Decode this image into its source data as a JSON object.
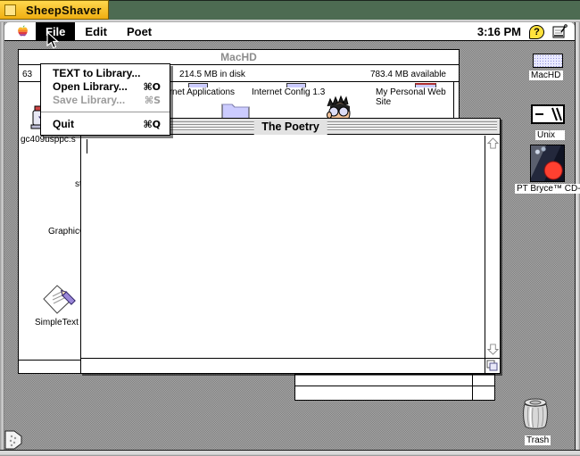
{
  "emulator": {
    "tab_title": "SheepShaver",
    "colors": {
      "tab_yellow": "#f2b613",
      "frame_green": "#4d6b52",
      "lavender": "#ccccff"
    }
  },
  "menubar": {
    "apple_icon": "rainbow-apple-logo",
    "menus": [
      {
        "label": "File",
        "highlighted": true
      },
      {
        "label": "Edit",
        "highlighted": false
      },
      {
        "label": "Poet",
        "highlighted": false
      }
    ],
    "clock": "3:16 PM",
    "help_glyph": "?",
    "app_icon": "active-application-icon"
  },
  "file_menu": {
    "items": [
      {
        "label": "TEXT to Library...",
        "shortcut": "",
        "disabled": false
      },
      {
        "label": "Open Library...",
        "shortcut": "⌘O",
        "disabled": false
      },
      {
        "label": "Save Library...",
        "shortcut": "⌘S",
        "disabled": true
      },
      {
        "label": "Quit",
        "shortcut": "⌘Q",
        "disabled": false
      }
    ]
  },
  "machd_window": {
    "title": "MacHD",
    "item_count": "63",
    "disk_used": "214.5 MB in disk",
    "disk_available": "783.4 MB available",
    "row_items": [
      "Internet Applications",
      "Internet Config 1.3",
      "My Personal Web Site"
    ],
    "left_labels": {
      "gc": "gc409usppc.s",
      "st": "st",
      "graphic": "GraphicC",
      "simpletext": "SimpleText"
    }
  },
  "poetry_window": {
    "title": "The Poetry"
  },
  "desktop_icons": {
    "machd": "MacHD",
    "unix": "Unix",
    "bryce": "PT Bryce™ CD-RO",
    "trash": "Trash"
  }
}
